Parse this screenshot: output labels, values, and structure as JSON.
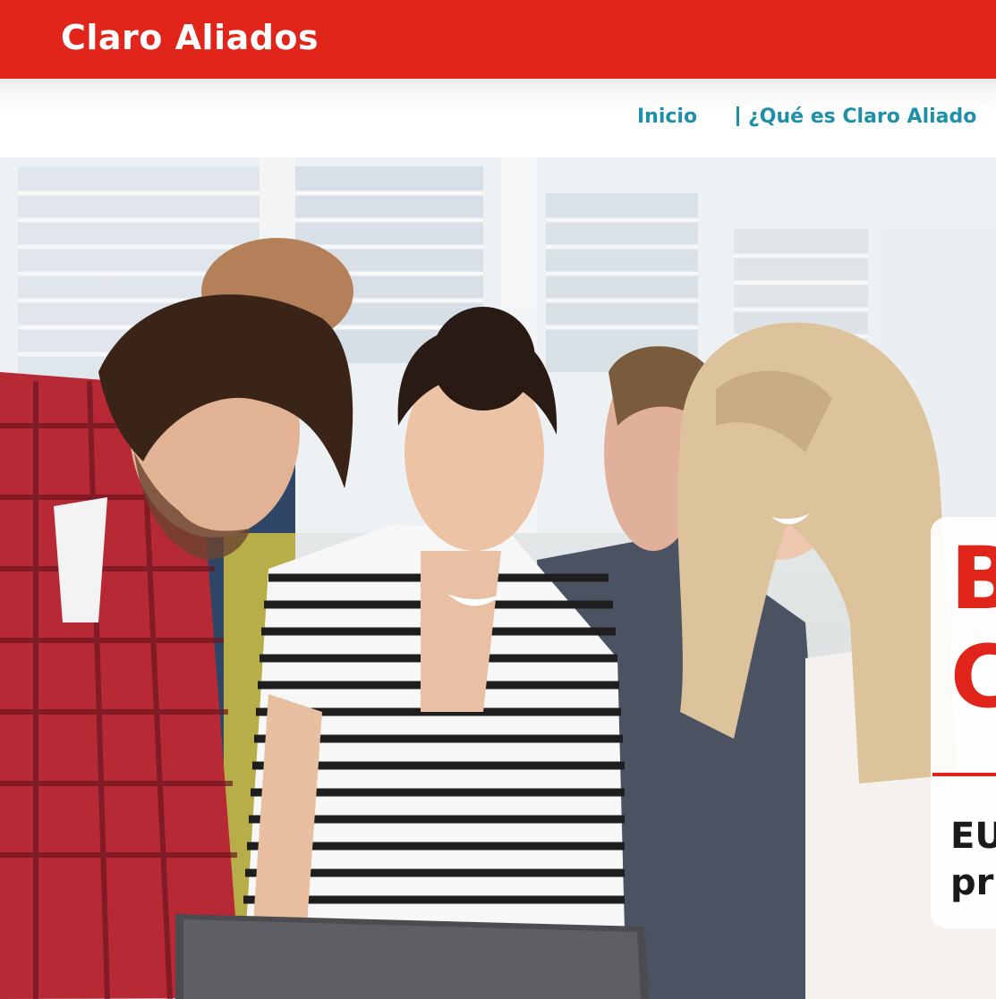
{
  "header": {
    "brand": "Claro Aliados",
    "background_color": "#e1251b"
  },
  "nav": {
    "items": [
      {
        "label": "Inicio"
      },
      {
        "label": "¿Qué es Claro Aliado"
      }
    ],
    "link_color": "#1d8fa8"
  },
  "hero": {
    "image_icon": "team-photo-people-around-laptop",
    "title": "B\nC",
    "subtitle": "EU\npr",
    "accent_color": "#e1251b"
  }
}
